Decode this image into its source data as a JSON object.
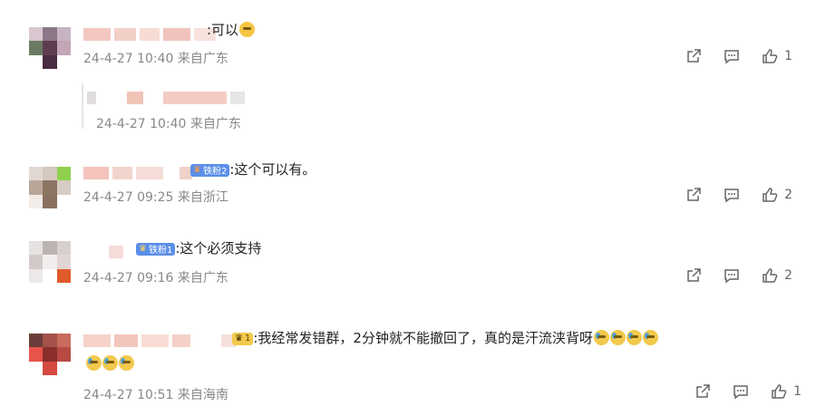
{
  "comments": [
    {
      "text": ":可以",
      "meta": "24-4-27 10:40 来自广东",
      "likes": "1",
      "reply_meta": "24-4-27 10:40 来自广东"
    },
    {
      "badge": "铁粉2",
      "text": ":这个可以有。",
      "meta": "24-4-27 09:25 来自浙江",
      "likes": "2"
    },
    {
      "badge": "铁粉1",
      "text": ":这个必须支持",
      "meta": "24-4-27 09:16 来自广东",
      "likes": "2"
    },
    {
      "badge": "1",
      "text": ":我经常发错群，2分钟就不能撤回了，真的是汗流浃背呀",
      "meta": "24-4-27 10:51 来自海南",
      "likes": "1"
    }
  ],
  "icons": [
    "share-icon",
    "comment-icon",
    "like-icon",
    "emoji-smile-icon",
    "emoji-cry-icon",
    "fan-badge-icon"
  ],
  "colors": {
    "meta": "#888888",
    "badge": "#5b8fe8",
    "text": "#222222"
  }
}
